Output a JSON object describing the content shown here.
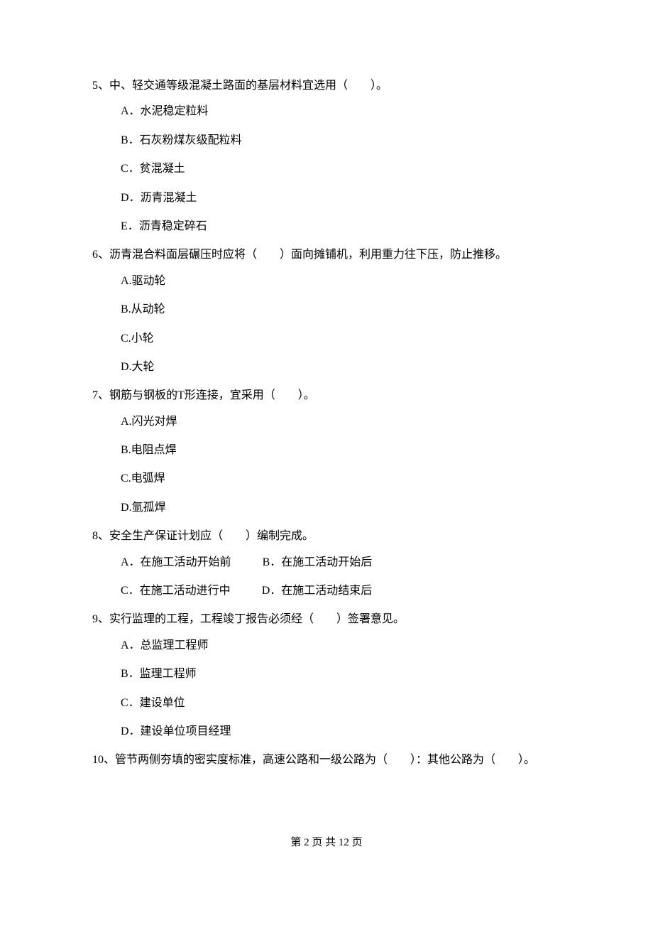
{
  "q5": {
    "stem": "5、中、轻交通等级混凝土路面的基层材料宜选用（　　）。",
    "A": "A．水泥稳定粒料",
    "B": "B．石灰粉煤灰级配粒料",
    "C": "C．贫混凝土",
    "D": "D．沥青混凝土",
    "E": "E．沥青稳定碎石"
  },
  "q6": {
    "stem": "6、沥青混合料面层碾压时应将（　　）面向摊铺机，利用重力往下压，防止推移。",
    "A": "A.驱动轮",
    "B": "B.从动轮",
    "C": "C.小轮",
    "D": "D.大轮"
  },
  "q7": {
    "stem": "7、钢筋与钢板的T形连接，宜采用（　　）。",
    "A": "A.闪光对焊",
    "B": "B.电阻点焊",
    "C": "C.电弧焊",
    "D": "D.氩孤焊"
  },
  "q8": {
    "stem": "8、安全生产保证计划应（　　）编制完成。",
    "A": "A．在施工活动开始前",
    "B": "B．在施工活动开始后",
    "C": "C．在施工活动进行中",
    "D": "D．在施工活动结束后"
  },
  "q9": {
    "stem": "9、实行监理的工程，工程竣丁报告必须经（　　）签署意见。",
    "A": "A．总监理工程师",
    "B": "B．监理工程师",
    "C": "C．建设单位",
    "D": "D．建设单位项目经理"
  },
  "q10": {
    "stem": "10、管节两侧夯填的密实度标准，高速公路和一级公路为（　　）：其他公路为（　　）。"
  },
  "pager": "第 2 页 共 12 页"
}
